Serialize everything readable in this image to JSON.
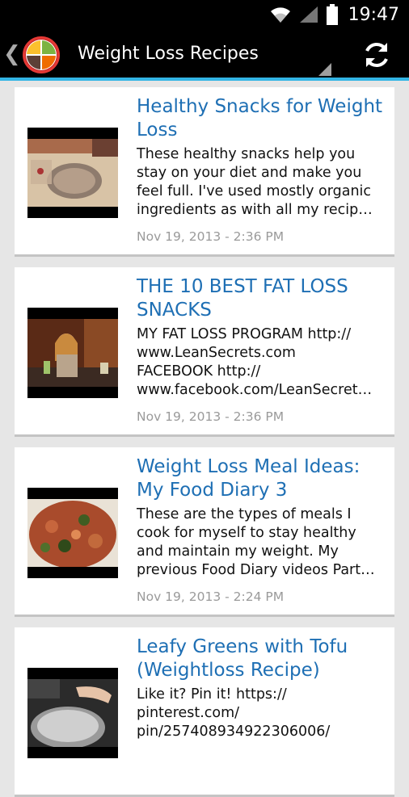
{
  "status_bar": {
    "time": "19:47",
    "icons": [
      "wifi-icon",
      "signal-icon",
      "battery-icon"
    ]
  },
  "action_bar": {
    "title": "Weight Loss Recipes",
    "back_icon": "chevron-left-icon",
    "refresh_icon": "refresh-icon",
    "accent_color": "#33b5e5"
  },
  "colors": {
    "title_link": "#1e6fb4",
    "date": "#9a9a9a",
    "background": "#e6e6e6"
  },
  "items": [
    {
      "title": "Healthy Snacks for Weight Loss",
      "desc_lines": [
        "These healthy snacks help you",
        "stay on your diet and make you",
        "feel full. I've used mostly organic",
        "ingredients as with all my recipe…"
      ],
      "date": "Nov 19, 2013 - 2:36 PM"
    },
    {
      "title": "THE 10 BEST FAT LOSS SNACKS",
      "desc_lines": [
        "MY FAT LOSS PROGRAM http://",
        "www.LeanSecrets.com",
        "FACEBOOK http://",
        "www.facebook.com/LeanSecret…"
      ],
      "date": "Nov 19, 2013 - 2:36 PM"
    },
    {
      "title": "Weight Loss Meal Ideas: My Food Diary 3",
      "desc_lines": [
        "These are the types of meals I",
        "cook for myself to stay healthy",
        "and maintain my weight. My",
        "previous Food Diary videos Part …"
      ],
      "date": "Nov 19, 2013 - 2:24 PM"
    },
    {
      "title": "Leafy Greens with Tofu (Weightloss Recipe)",
      "desc_lines": [
        "Like it? Pin it! https://",
        "pinterest.com/",
        "pin/257408934922306006/"
      ],
      "date": ""
    }
  ]
}
